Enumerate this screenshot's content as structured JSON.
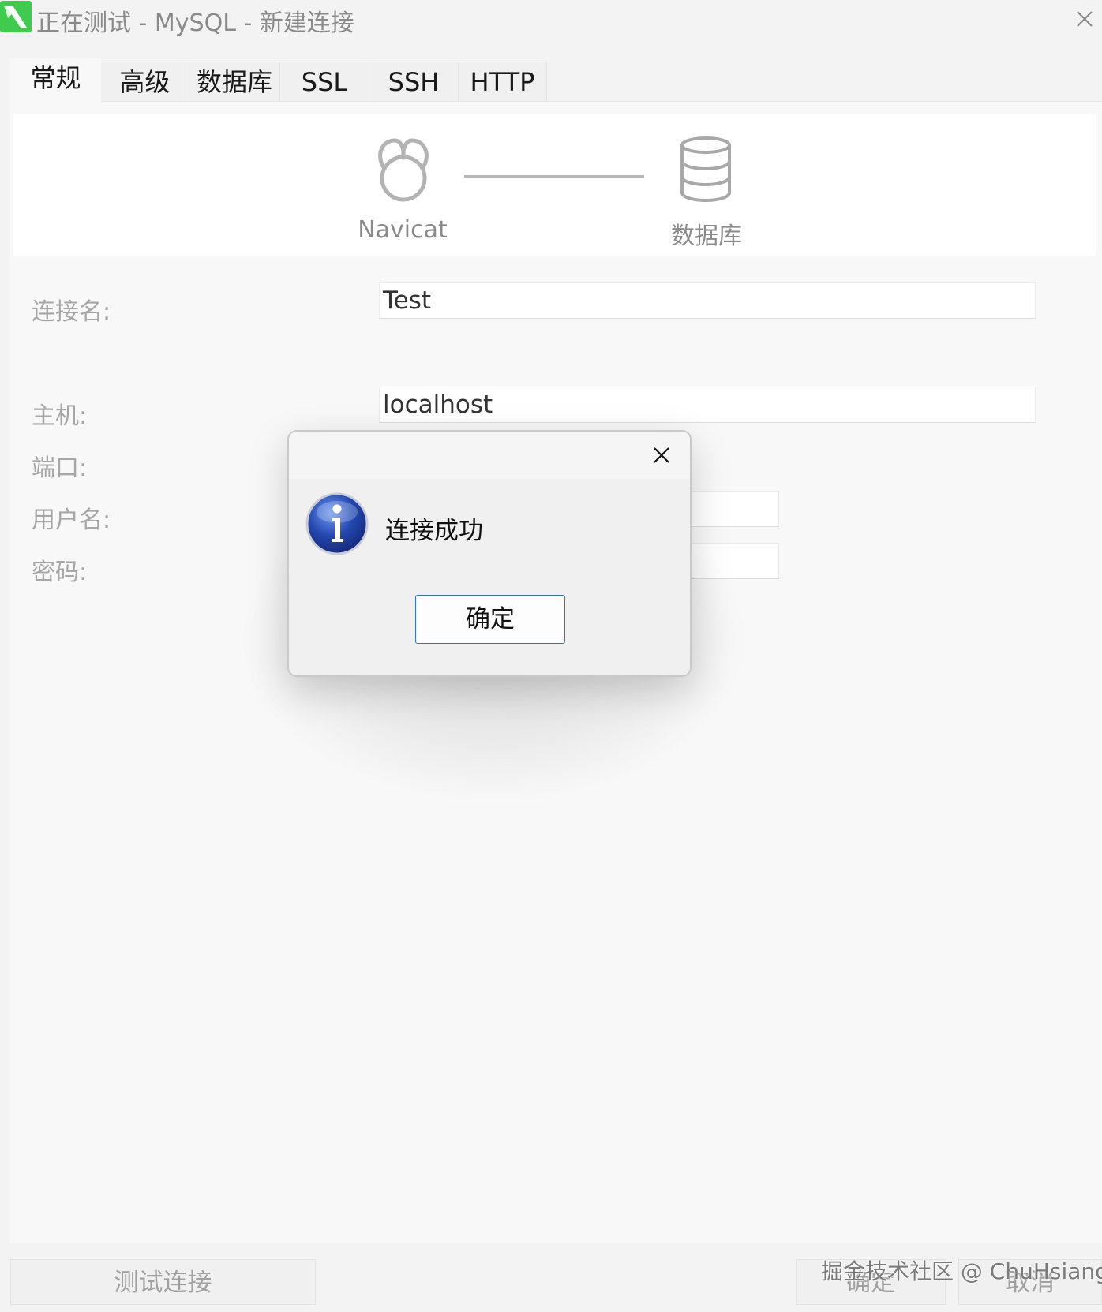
{
  "window": {
    "title": "正在测试 - MySQL - 新建连接"
  },
  "tabs": [
    {
      "label": "常规"
    },
    {
      "label": "高级"
    },
    {
      "label": "数据库"
    },
    {
      "label": "SSL"
    },
    {
      "label": "SSH"
    },
    {
      "label": "HTTP"
    }
  ],
  "banner": {
    "navicat_label": "Navicat",
    "database_label": "数据库"
  },
  "form": {
    "connection_name": {
      "label": "连接名:",
      "value": "Test"
    },
    "host": {
      "label": "主机:",
      "value": "localhost"
    },
    "port": {
      "label": "端口:"
    },
    "username": {
      "label": "用户名:"
    },
    "password": {
      "label": "密码:"
    }
  },
  "dialog": {
    "message": "连接成功",
    "ok_label": "确定"
  },
  "footer": {
    "test_connection": "测试连接",
    "ok": "确定",
    "cancel": "取消"
  },
  "watermark": "掘金技术社区 @ ChuHsiang",
  "colors": {
    "app_icon_green": "#3ecb4e",
    "info_blue": "#2447b0",
    "ok_border": "#2f73c6"
  }
}
